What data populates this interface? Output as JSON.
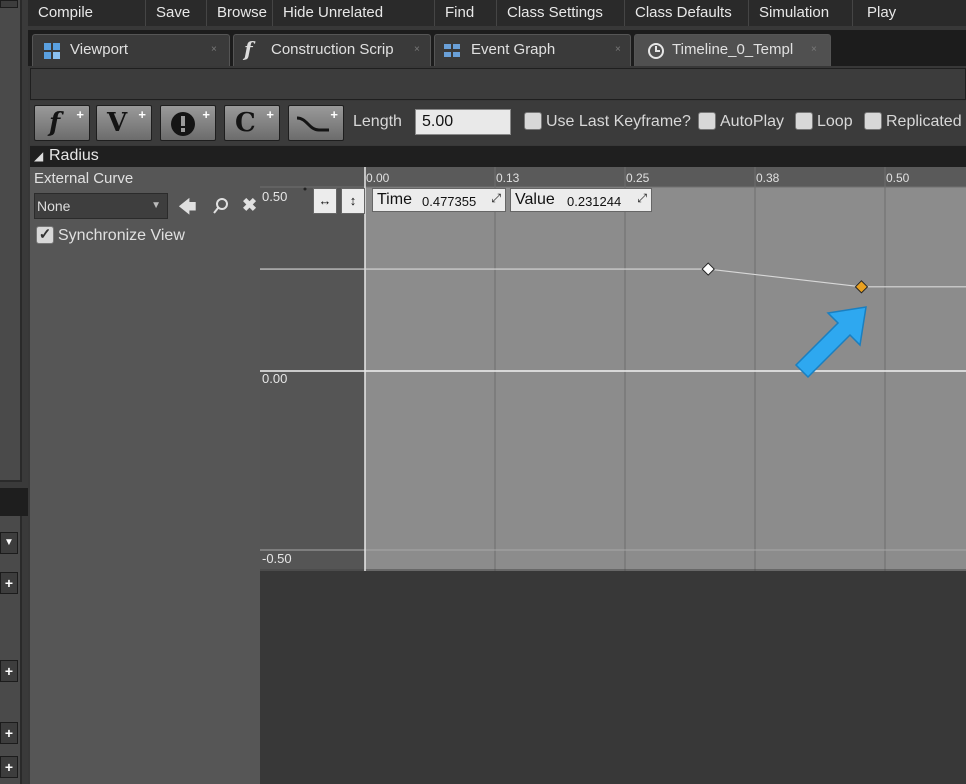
{
  "toolbar": {
    "items": [
      "Compile",
      "Save",
      "Browse",
      "Hide Unrelated",
      "Find",
      "Class Settings",
      "Class Defaults",
      "Simulation",
      "Play"
    ]
  },
  "tabs": [
    {
      "label": "Viewport",
      "icon": "viewport-icon"
    },
    {
      "label": "Construction Scrip",
      "icon": "function-icon"
    },
    {
      "label": "Event Graph",
      "icon": "event-graph-icon"
    },
    {
      "label": "Timeline_0_Templ",
      "icon": "clock-icon",
      "active": true
    }
  ],
  "timeline_toolbar": {
    "buttons": [
      {
        "glyph": "f",
        "icon": "add-float-track-icon"
      },
      {
        "glyph": "V",
        "icon": "add-vector-track-icon"
      },
      {
        "glyph": "!",
        "icon": "add-event-track-icon"
      },
      {
        "glyph": "C",
        "icon": "add-color-track-icon"
      },
      {
        "glyph": "",
        "icon": "add-curve-asset-icon"
      }
    ],
    "length_label": "Length",
    "length_value": "5.00",
    "checkboxes": [
      "Use Last Keyframe?",
      "AutoPlay",
      "Loop",
      "Replicated"
    ]
  },
  "track": {
    "name": "Radius",
    "external_curve_label": "External Curve",
    "external_curve_value": "None",
    "synchronize_label": "Synchronize View",
    "synchronize_checked": true
  },
  "graph": {
    "time_label": "Time",
    "time_value": "0.477355",
    "value_label": "Value",
    "value_value": "0.231244",
    "y_ticks": [
      "0.50",
      "0.00",
      "-0.50"
    ],
    "x_ticks": [
      "0.00",
      "0.13",
      "0.25",
      "0.38",
      "0.50"
    ],
    "keys": [
      {
        "time": 0.33,
        "value": 0.28,
        "selected": false
      },
      {
        "time": 0.477355,
        "value": 0.231244,
        "selected": true
      }
    ],
    "colors": {
      "curve": "#d8d8d8",
      "selected_key": "#e8a020",
      "key": "#ffffff",
      "arrow": "#2ea8f0"
    }
  }
}
